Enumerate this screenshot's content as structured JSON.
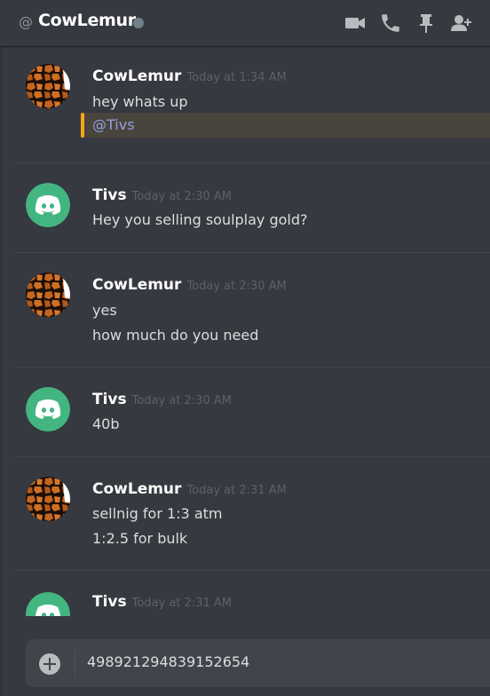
{
  "header": {
    "at_symbol": "@",
    "channel_name": "CowLemur",
    "status": "offline",
    "icons": [
      "video-call-icon",
      "voice-call-icon",
      "pin-icon",
      "add-friend-icon"
    ]
  },
  "messages": [
    {
      "author": "CowLemur",
      "timestamp": "Today at 1:34 AM",
      "avatar": "giraffe-pattern",
      "lines": [
        "hey whats up"
      ],
      "mention": "@Tivs"
    },
    {
      "author": "Tivs",
      "timestamp": "Today at 2:30 AM",
      "avatar": "discord-default",
      "lines": [
        "Hey you selling soulplay gold?"
      ]
    },
    {
      "author": "CowLemur",
      "timestamp": "Today at 2:30 AM",
      "avatar": "giraffe-pattern",
      "lines": [
        "yes",
        "how much do you need"
      ]
    },
    {
      "author": "Tivs",
      "timestamp": "Today at 2:30 AM",
      "avatar": "discord-default",
      "lines": [
        "40b"
      ]
    },
    {
      "author": "CowLemur",
      "timestamp": "Today at 2:31 AM",
      "avatar": "giraffe-pattern",
      "lines": [
        "sellnig for 1:3 atm",
        "1:2.5 for bulk"
      ]
    },
    {
      "author": "Tivs",
      "timestamp": "Today at 2:31 AM",
      "avatar": "discord-default",
      "lines": []
    }
  ],
  "composer": {
    "value": "498921294839152654"
  },
  "colors": {
    "background": "#36393f",
    "mention_highlight": "#49443c",
    "mention_bar": "#faa61a",
    "mention_text": "#8ea1e1",
    "discord_avatar": "#43b581",
    "status_offline": "#747f8d"
  }
}
